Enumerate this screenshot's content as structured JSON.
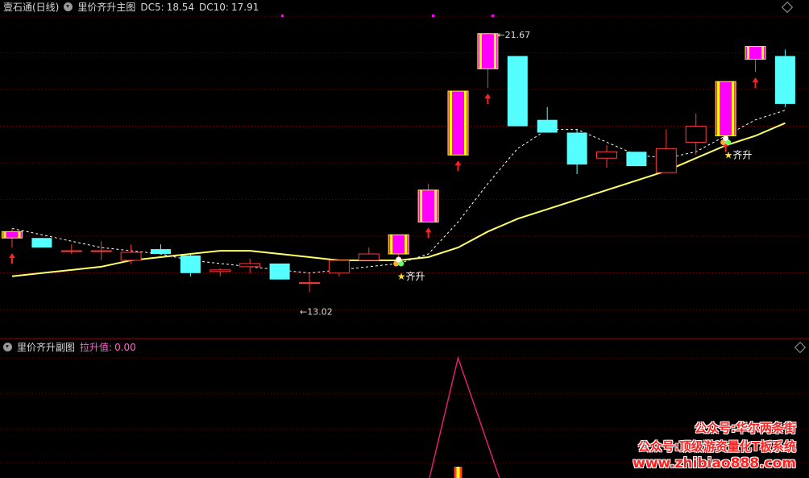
{
  "main_header": {
    "app": "壹石通(日线)",
    "indicator": "里价齐升主图",
    "dc5_label": "DC5:",
    "dc5_value": "18.54",
    "dc10_label": "DC10:",
    "dc10_value": "17.91"
  },
  "sub_header": {
    "indicator": "里价齐升副图",
    "value_label": "拉升值:",
    "value": "0.00"
  },
  "watermark": {
    "line1": "公众号:华尔两条街",
    "line2": "公众号:顶级游资量化T板系统",
    "line3": "www.zhibiao888.com"
  },
  "colors": {
    "up_candle": "#ff3b3b",
    "down_candle": "#55ffff",
    "dc10_line": "#ffff66",
    "dc5_line": "#ffffff",
    "signal_magenta": "#ff00ff",
    "signal_yellow": "#ffff00",
    "arrow": "#ff2020",
    "grid": "#7a0000",
    "divider": "#a00000",
    "sub_line": "#e0206a",
    "header_value": "#ff66cc"
  },
  "chart_data": {
    "type": "candlestick",
    "price_range": [
      12.2,
      22.3
    ],
    "annotations": {
      "high_label": "21.67",
      "low_label": "13.02",
      "signal_text": "齐升"
    },
    "candles": [
      {
        "o": 15.3,
        "h": 15.6,
        "l": 15.0,
        "c": 15.5,
        "signal": true,
        "arrow": true
      },
      {
        "o": 15.3,
        "h": 15.3,
        "l": 15.0,
        "c": 15.0,
        "signal": false,
        "arrow": false
      },
      {
        "o": 14.9,
        "h": 15.1,
        "l": 14.8,
        "c": 14.9,
        "signal": false,
        "arrow": false
      },
      {
        "o": 14.9,
        "h": 15.2,
        "l": 14.6,
        "c": 14.9,
        "signal": false,
        "arrow": false
      },
      {
        "o": 14.6,
        "h": 15.1,
        "l": 14.5,
        "c": 14.85,
        "signal": false,
        "arrow": false
      },
      {
        "o": 14.95,
        "h": 15.1,
        "l": 14.8,
        "c": 14.8,
        "signal": false,
        "arrow": false
      },
      {
        "o": 14.75,
        "h": 14.8,
        "l": 14.1,
        "c": 14.2,
        "signal": false,
        "arrow": false
      },
      {
        "o": 14.25,
        "h": 14.35,
        "l": 14.1,
        "c": 14.3,
        "signal": false,
        "arrow": false
      },
      {
        "o": 14.4,
        "h": 14.65,
        "l": 14.2,
        "c": 14.5,
        "signal": false,
        "arrow": false
      },
      {
        "o": 14.5,
        "h": 14.5,
        "l": 14.0,
        "c": 14.0,
        "signal": false,
        "arrow": false
      },
      {
        "o": 13.9,
        "h": 14.2,
        "l": 13.6,
        "c": 13.9,
        "signal": false,
        "arrow": false
      },
      {
        "o": 14.2,
        "h": 14.6,
        "l": 14.1,
        "c": 14.6,
        "signal": false,
        "arrow": false
      },
      {
        "o": 14.6,
        "h": 15.0,
        "l": 14.6,
        "c": 14.8,
        "signal": false,
        "arrow": false
      },
      {
        "o": 14.8,
        "h": 15.4,
        "l": 14.7,
        "c": 15.4,
        "signal": true,
        "arrow": false
      },
      {
        "o": 15.8,
        "h": 17.0,
        "l": 15.8,
        "c": 16.8,
        "signal": true,
        "arrow": true
      },
      {
        "o": 17.9,
        "h": 19.9,
        "l": 17.9,
        "c": 19.9,
        "signal": true,
        "arrow": true
      },
      {
        "o": 20.6,
        "h": 21.7,
        "l": 20.0,
        "c": 21.7,
        "signal": true,
        "arrow": true
      },
      {
        "o": 21.0,
        "h": 21.0,
        "l": 18.8,
        "c": 18.8,
        "signal": false,
        "arrow": false
      },
      {
        "o": 19.0,
        "h": 19.4,
        "l": 18.6,
        "c": 18.6,
        "signal": false,
        "arrow": false
      },
      {
        "o": 18.6,
        "h": 18.7,
        "l": 17.3,
        "c": 17.6,
        "signal": false,
        "arrow": false
      },
      {
        "o": 17.8,
        "h": 18.2,
        "l": 17.5,
        "c": 18.0,
        "signal": false,
        "arrow": false
      },
      {
        "o": 18.0,
        "h": 18.0,
        "l": 17.55,
        "c": 17.55,
        "signal": false,
        "arrow": false
      },
      {
        "o": 17.35,
        "h": 18.7,
        "l": 17.35,
        "c": 18.1,
        "signal": false,
        "arrow": false
      },
      {
        "o": 18.3,
        "h": 19.2,
        "l": 17.9,
        "c": 18.8,
        "signal": false,
        "arrow": false
      },
      {
        "o": 18.5,
        "h": 20.2,
        "l": 18.5,
        "c": 20.2,
        "signal": true,
        "arrow": true
      },
      {
        "o": 20.9,
        "h": 21.3,
        "l": 20.5,
        "c": 21.3,
        "signal": true,
        "arrow": true
      },
      {
        "o": 21.0,
        "h": 21.2,
        "l": 19.4,
        "c": 19.5,
        "signal": false,
        "arrow": false
      }
    ],
    "dc10": [
      14.1,
      14.2,
      14.3,
      14.4,
      14.6,
      14.7,
      14.8,
      14.9,
      14.9,
      14.8,
      14.7,
      14.6,
      14.6,
      14.6,
      14.7,
      15.0,
      15.5,
      15.9,
      16.2,
      16.5,
      16.8,
      17.1,
      17.4,
      17.8,
      18.2,
      18.5,
      18.9
    ],
    "dc5": [
      15.6,
      15.4,
      15.2,
      15.0,
      14.9,
      14.8,
      14.6,
      14.5,
      14.4,
      14.3,
      14.2,
      14.3,
      14.4,
      14.5,
      14.8,
      15.8,
      17.0,
      18.1,
      18.7,
      18.7,
      18.3,
      17.9,
      17.8,
      18.0,
      18.5,
      19.0,
      19.3
    ],
    "sub_series": {
      "name": "拉升值",
      "x": [
        14.2,
        15.0,
        15.8
      ],
      "y": [
        0,
        1,
        0
      ],
      "bar_index": 15
    }
  }
}
